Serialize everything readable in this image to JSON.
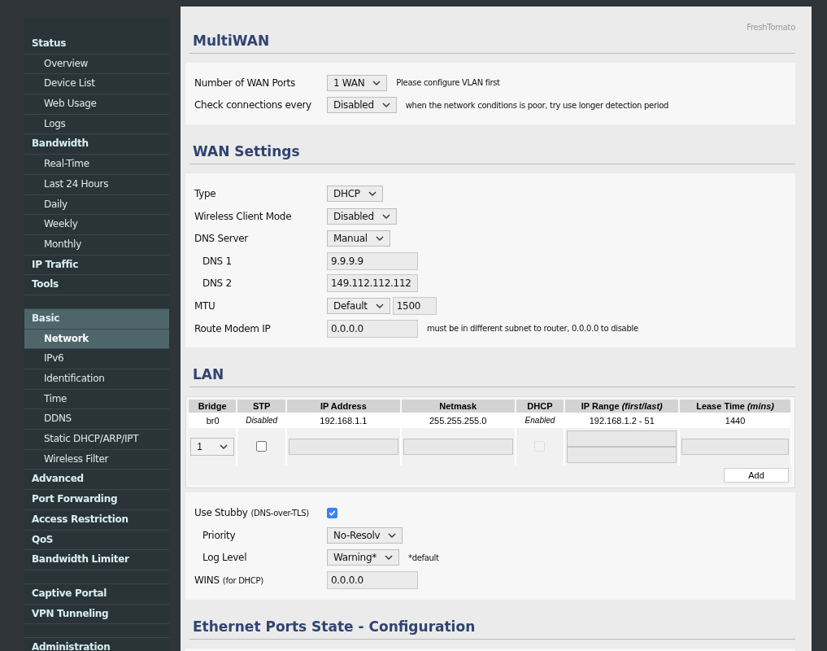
{
  "brand": "FreshTomato",
  "sidebar": {
    "groups": [
      [
        {
          "label": "Status",
          "kind": "section",
          "selected": false
        },
        {
          "label": "Overview",
          "kind": "page",
          "selected": false
        },
        {
          "label": "Device List",
          "kind": "page",
          "selected": false
        },
        {
          "label": "Web Usage",
          "kind": "page",
          "selected": false
        },
        {
          "label": "Logs",
          "kind": "page",
          "selected": false
        },
        {
          "label": "Bandwidth",
          "kind": "section",
          "selected": false
        },
        {
          "label": "Real-Time",
          "kind": "page",
          "selected": false
        },
        {
          "label": "Last 24 Hours",
          "kind": "page",
          "selected": false
        },
        {
          "label": "Daily",
          "kind": "page",
          "selected": false
        },
        {
          "label": "Weekly",
          "kind": "page",
          "selected": false
        },
        {
          "label": "Monthly",
          "kind": "page",
          "selected": false
        },
        {
          "label": "IP Traffic",
          "kind": "section",
          "selected": false
        },
        {
          "label": "Tools",
          "kind": "section",
          "selected": false
        }
      ],
      [
        {
          "label": "Basic",
          "kind": "section",
          "selected": true
        },
        {
          "label": "Network",
          "kind": "page",
          "selected": true
        },
        {
          "label": "IPv6",
          "kind": "page",
          "selected": false
        },
        {
          "label": "Identification",
          "kind": "page",
          "selected": false
        },
        {
          "label": "Time",
          "kind": "page",
          "selected": false
        },
        {
          "label": "DDNS",
          "kind": "page",
          "selected": false
        },
        {
          "label": "Static DHCP/ARP/IPT",
          "kind": "page",
          "selected": false
        },
        {
          "label": "Wireless Filter",
          "kind": "page",
          "selected": false
        },
        {
          "label": "Advanced",
          "kind": "section",
          "selected": false
        },
        {
          "label": "Port Forwarding",
          "kind": "section",
          "selected": false
        },
        {
          "label": "Access Restriction",
          "kind": "section",
          "selected": false
        },
        {
          "label": "QoS",
          "kind": "section",
          "selected": false
        },
        {
          "label": "Bandwidth Limiter",
          "kind": "section",
          "selected": false
        }
      ],
      [
        {
          "label": "Captive Portal",
          "kind": "section",
          "selected": false
        },
        {
          "label": "VPN Tunneling",
          "kind": "section",
          "selected": false
        }
      ],
      [
        {
          "label": "Administration",
          "kind": "section",
          "selected": false
        }
      ]
    ]
  },
  "multiwan": {
    "title": "MultiWAN",
    "rows": [
      {
        "label": "Number of WAN Ports",
        "indented": false,
        "controls": [
          {
            "kind": "select",
            "value": "1 WAN"
          }
        ],
        "note": "Please configure VLAN first"
      },
      {
        "label": "Check connections every",
        "indented": false,
        "controls": [
          {
            "kind": "select",
            "value": "Disabled"
          }
        ],
        "note": "when the network conditions is poor, try use longer detection period"
      }
    ]
  },
  "wan": {
    "title": "WAN Settings",
    "rows": [
      {
        "label": "Type",
        "indented": false,
        "controls": [
          {
            "kind": "select",
            "value": "DHCP"
          }
        ]
      },
      {
        "label": "Wireless Client Mode",
        "indented": false,
        "controls": [
          {
            "kind": "select",
            "value": "Disabled"
          }
        ]
      },
      {
        "label": "DNS Server",
        "indented": false,
        "controls": [
          {
            "kind": "select",
            "value": "Manual"
          }
        ]
      },
      {
        "label": "DNS 1",
        "indented": true,
        "controls": [
          {
            "kind": "input",
            "value": "9.9.9.9"
          }
        ]
      },
      {
        "label": "DNS 2",
        "indented": true,
        "controls": [
          {
            "kind": "input",
            "value": "149.112.112.112"
          }
        ]
      },
      {
        "label": "MTU",
        "indented": false,
        "controls": [
          {
            "kind": "select",
            "value": "Default"
          },
          {
            "kind": "short-input",
            "value": "1500"
          }
        ]
      },
      {
        "label": "Route Modem IP",
        "indented": false,
        "controls": [
          {
            "kind": "input",
            "value": "0.0.0.0"
          }
        ],
        "note": "must be in different subnet to router, 0.0.0.0 to disable"
      }
    ]
  },
  "lan": {
    "title": "LAN",
    "columns": [
      "Bridge",
      "STP",
      "IP Address",
      "Netmask",
      "DHCP",
      "IP Range *(first/last)*",
      "Lease Time *(mins)*"
    ],
    "rows": [
      {
        "cells": [
          {
            "kind": "text",
            "text": "br0"
          },
          {
            "kind": "status",
            "text": "Disabled"
          },
          {
            "kind": "text",
            "text": "192.168.1.1"
          },
          {
            "kind": "text",
            "text": "255.255.255.0"
          },
          {
            "kind": "status",
            "text": "Enabled"
          },
          {
            "kind": "text",
            "text": "192.168.1.2 - 51"
          },
          {
            "kind": "text",
            "text": "1440"
          }
        ]
      }
    ],
    "new_row": {
      "bridge": "1",
      "stp_checked": false,
      "dhcp_checked": false,
      "dhcp_disabled": true
    },
    "add_button": "Add"
  },
  "dns": {
    "rows": [
      {
        "label": "Use Stubby",
        "label_note": "(DNS-over-TLS)",
        "indented": false,
        "controls": [
          {
            "kind": "checkbox",
            "checked": true
          }
        ]
      },
      {
        "label": "Priority",
        "indented": true,
        "controls": [
          {
            "kind": "select",
            "value": "No-Resolv"
          }
        ]
      },
      {
        "label": "Log Level",
        "indented": true,
        "controls": [
          {
            "kind": "select",
            "value": "Warning*"
          }
        ],
        "note": "*default"
      },
      {
        "label": "WINS",
        "label_note": "(for DHCP)",
        "indented": false,
        "controls": [
          {
            "kind": "input",
            "value": "0.0.0.0"
          }
        ]
      }
    ]
  },
  "ethernet": {
    "title": "Ethernet Ports State - Configuration"
  }
}
